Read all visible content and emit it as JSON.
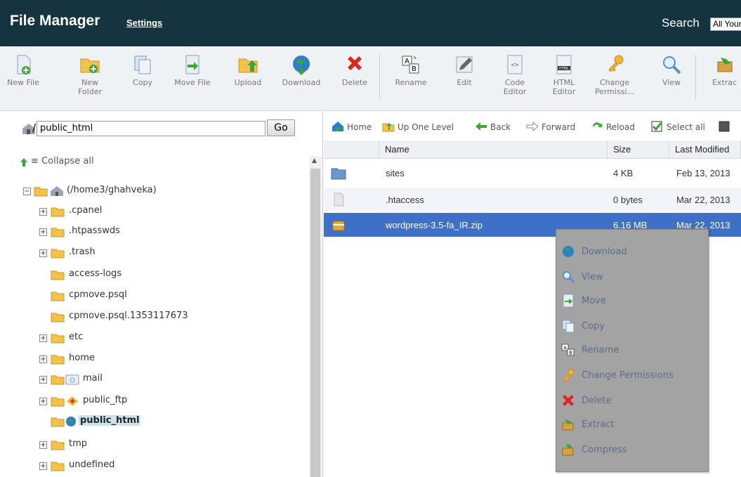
{
  "header": {
    "title": "File Manager",
    "settings_label": "Settings",
    "search_label": "Search",
    "search_scope": "All Your Files"
  },
  "toolbar": [
    {
      "label": "New File",
      "icon": "new-file-icon"
    },
    {
      "label": "New\nFolder",
      "icon": "new-folder-icon"
    },
    {
      "label": "Copy",
      "icon": "copy-icon"
    },
    {
      "label": "Move File",
      "icon": "move-file-icon"
    },
    {
      "label": "Upload",
      "icon": "upload-icon"
    },
    {
      "label": "Download",
      "icon": "download-icon"
    },
    {
      "label": "Delete",
      "icon": "delete-icon"
    },
    {
      "label": "Rename",
      "icon": "rename-icon"
    },
    {
      "label": "Edit",
      "icon": "edit-icon"
    },
    {
      "label": "Code\nEditor",
      "icon": "code-editor-icon"
    },
    {
      "label": "HTML\nEditor",
      "icon": "html-editor-icon"
    },
    {
      "label": "Change\nPermissi...",
      "icon": "change-permissions-icon"
    },
    {
      "label": "View",
      "icon": "view-icon"
    },
    {
      "label": "Extrac",
      "icon": "extract-icon"
    }
  ],
  "left": {
    "path_value": "public_html",
    "go_label": "Go",
    "collapse_label": "Collapse all",
    "tree": [
      {
        "label": "(/home3/ghahveka)"
      },
      {
        "label": ".cpanel"
      },
      {
        "label": ".htpasswds"
      },
      {
        "label": ".trash"
      },
      {
        "label": "access-logs"
      },
      {
        "label": "cpmove.psql"
      },
      {
        "label": "cpmove.psql.1353117673"
      },
      {
        "label": "etc"
      },
      {
        "label": "home"
      },
      {
        "label": "mail"
      },
      {
        "label": "public_ftp"
      },
      {
        "label": "public_html"
      },
      {
        "label": "tmp"
      },
      {
        "label": "undefined"
      }
    ]
  },
  "nav": {
    "home": "Home",
    "up": "Up One Level",
    "back": "Back",
    "forward": "Forward",
    "reload": "Reload",
    "select_all": "Select all"
  },
  "columns": {
    "name": "Name",
    "size": "Size",
    "modified": "Last Modified"
  },
  "files": [
    {
      "name": "sites",
      "size": "4 KB",
      "modified": "Feb 13, 2013"
    },
    {
      "name": ".htaccess",
      "size": "0 bytes",
      "modified": "Mar 22, 2013"
    },
    {
      "name": "wordpress-3.5-fa_IR.zip",
      "size": "6.16 MB",
      "modified": "Mar 22, 2013"
    }
  ],
  "context_menu": [
    {
      "label": "Download",
      "icon": "download-icon"
    },
    {
      "label": "View",
      "icon": "view-icon"
    },
    {
      "label": "Move",
      "icon": "move-icon"
    },
    {
      "label": "Copy",
      "icon": "copy-icon"
    },
    {
      "label": "Rename",
      "icon": "rename-icon"
    },
    {
      "label": "Change Permissions",
      "icon": "change-permissions-icon"
    },
    {
      "label": "Delete",
      "icon": "delete-icon"
    },
    {
      "label": "Extract",
      "icon": "extract-icon"
    },
    {
      "label": "Compress",
      "icon": "compress-icon"
    }
  ],
  "colors": {
    "header_bg": "#16343f",
    "selection_bg": "#3f70c7",
    "menu_bg": "#a3a3a3"
  }
}
